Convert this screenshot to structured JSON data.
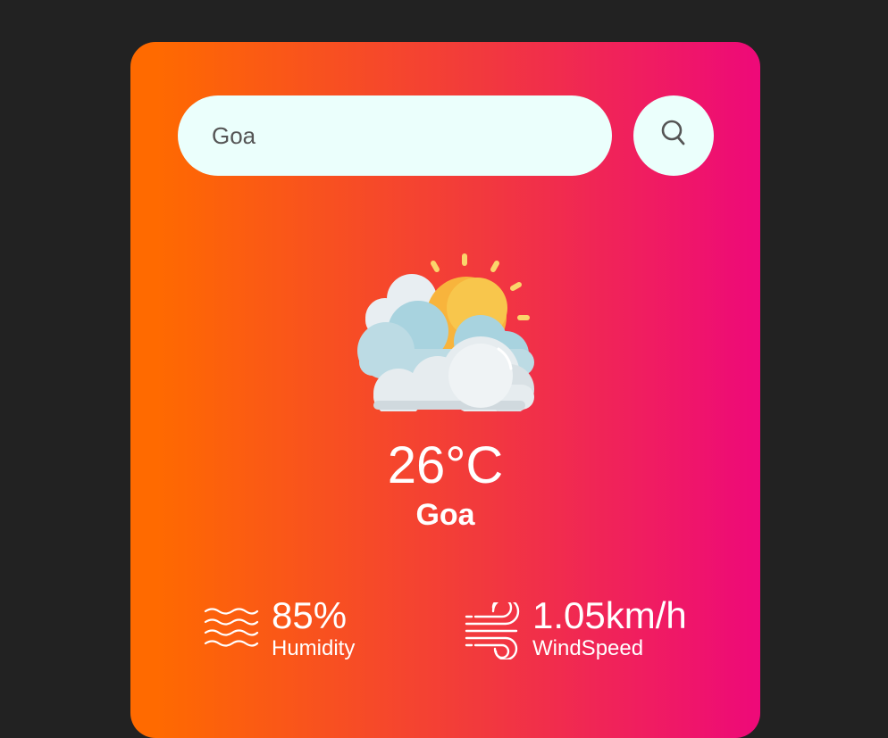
{
  "search": {
    "value": "Goa",
    "icon": "search-icon"
  },
  "weather": {
    "icon": "partly-cloudy-sun-icon",
    "temperature": "26°C",
    "city": "Goa"
  },
  "humidity": {
    "icon": "humidity-waves-icon",
    "value": "85%",
    "label": "Humidity"
  },
  "wind": {
    "icon": "wind-icon",
    "value": "1.05km/h",
    "label": "WindSpeed"
  },
  "colors": {
    "page_background": "#222222",
    "gradient_start": "#ff6a00",
    "gradient_end": "#ee0979",
    "search_background": "#ebfffc",
    "text": "#ffffff"
  }
}
